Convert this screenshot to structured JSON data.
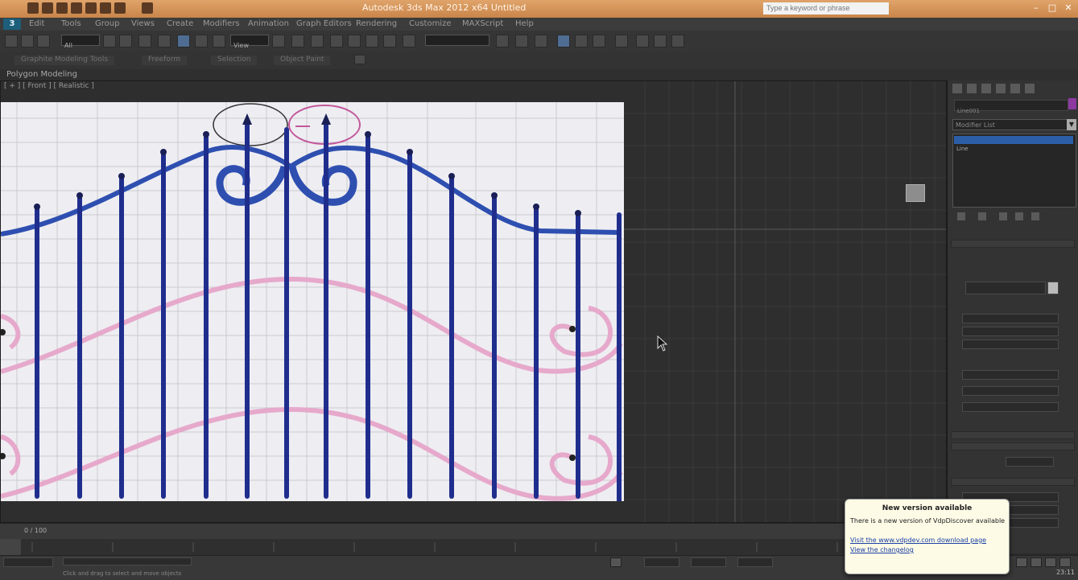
{
  "app": {
    "title": "Autodesk 3ds Max 2012 x64    Untitled",
    "search_placeholder": "Type a keyword or phrase",
    "logo_text": "3"
  },
  "window_controls": [
    "–",
    "□",
    "✕"
  ],
  "menu": [
    "Edit",
    "Tools",
    "Group",
    "Views",
    "Create",
    "Modifiers",
    "Animation",
    "Graph Editors",
    "Rendering",
    "Customize",
    "MAXScript",
    "Help"
  ],
  "toolbar": {
    "selection_filter": "All",
    "coord_system": "View"
  },
  "ribbon": {
    "tabs": [
      "Graphite Modeling Tools",
      "Freeform",
      "Selection",
      "Object Paint"
    ]
  },
  "subribbon": {
    "label": "Polygon Modeling"
  },
  "viewport": {
    "label": "[ + ] [ Front ] [ Realistic ]"
  },
  "command_panel": {
    "object_name": "Line001",
    "modifier_list": "Modifier List",
    "stack_items": [
      "Line"
    ]
  },
  "timeline": {
    "frame_label": "0 / 100"
  },
  "status": {
    "text": "Click and drag to select and move objects",
    "clock": "23:11"
  },
  "notification": {
    "title": "New version available",
    "body": "There is a new version of VdpDiscover available",
    "link1": "Visit the www.vdpdev.com download page",
    "link2": "View the changelog"
  },
  "colors": {
    "title_bar": "#d4965a",
    "selection_blue": "#2b5ea6",
    "gate_blue": "#1f2e8c",
    "gate_pink": "#e6a9cb",
    "object_color": "#8c3aa0"
  }
}
